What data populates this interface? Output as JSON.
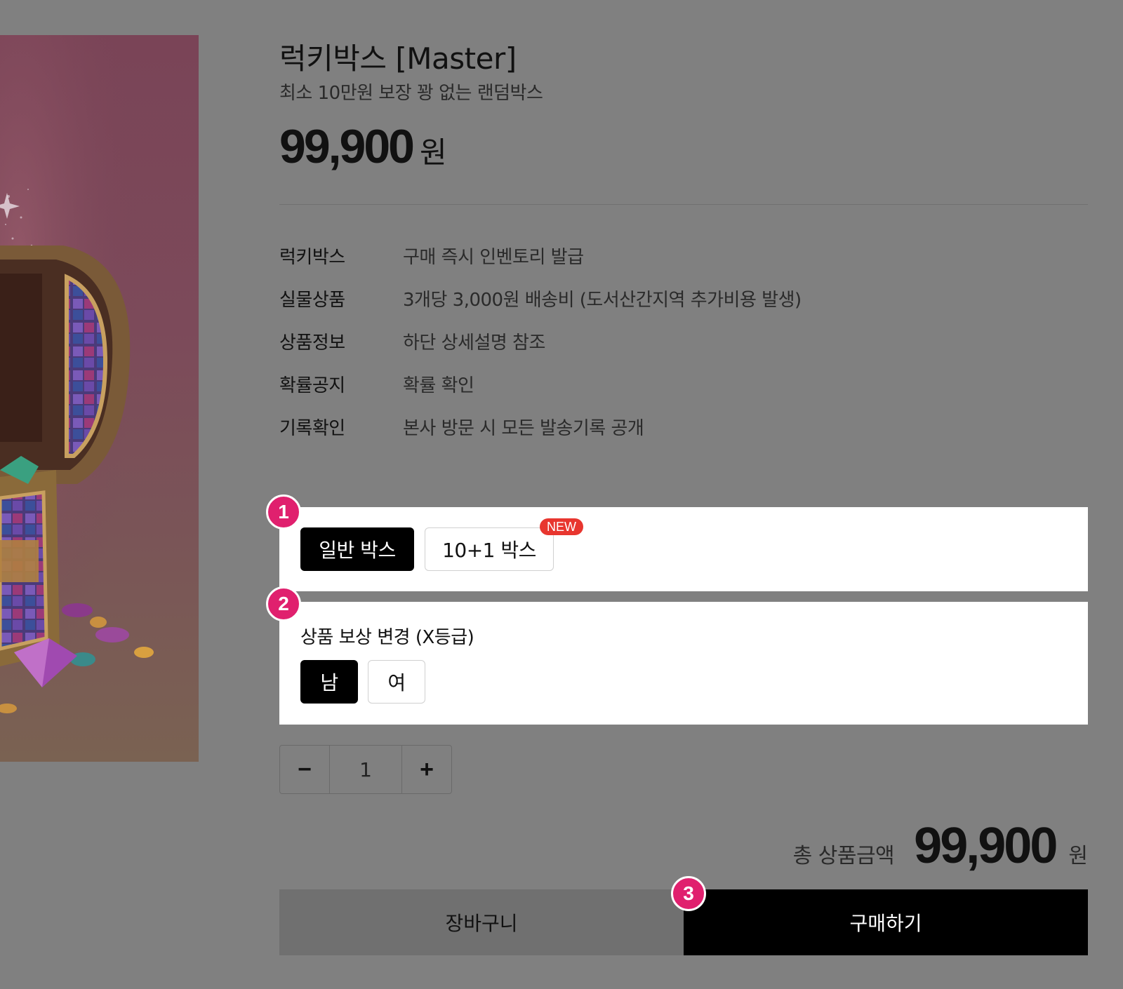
{
  "product": {
    "title": "럭키박스 [Master]",
    "subtitle": "최소 10만원 보장 꽝 없는 랜덤박스",
    "price": "99,900",
    "price_unit": "원"
  },
  "info": [
    {
      "label": "럭키박스",
      "value": "구매 즉시 인벤토리 발급"
    },
    {
      "label": "실물상품",
      "value": "3개당 3,000원 배송비 (도서산간지역 추가비용 발생)"
    },
    {
      "label": "상품정보",
      "value": "하단 상세설명 참조"
    },
    {
      "label": "확률공지",
      "value": "확률 확인"
    },
    {
      "label": "기록확인",
      "value": "본사 방문 시 모든 발송기록 공개"
    }
  ],
  "steps": [
    "1",
    "2",
    "3"
  ],
  "box_options": {
    "items": [
      {
        "label": "일반 박스",
        "selected": true
      },
      {
        "label": "10+1 박스",
        "selected": false,
        "badge": "NEW"
      }
    ]
  },
  "reward_options": {
    "title": "상품 보상 변경 (X등급)",
    "items": [
      {
        "label": "남",
        "selected": true
      },
      {
        "label": "여",
        "selected": false
      }
    ]
  },
  "quantity": {
    "minus": "−",
    "value": "1",
    "plus": "+"
  },
  "total": {
    "label": "총 상품금액",
    "amount": "99,900",
    "unit": "원"
  },
  "actions": {
    "cart": "장바구니",
    "buy": "구매하기"
  },
  "colors": {
    "overlay": "#808080",
    "accent": "#e0206e",
    "new_badge": "#e8362f",
    "selected": "#000000"
  }
}
